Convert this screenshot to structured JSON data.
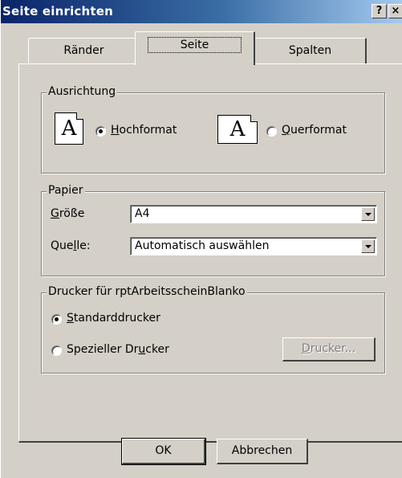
{
  "window": {
    "title": "Seite einrichten",
    "help_button": "?",
    "close_button": "×"
  },
  "tabs": [
    {
      "label": "Ränder",
      "active": false
    },
    {
      "label": "Seite",
      "active": true
    },
    {
      "label": "Spalten",
      "active": false
    }
  ],
  "ausrichtung": {
    "title": "Ausrichtung",
    "hochformat": {
      "icon_glyph": "A",
      "accel": "H",
      "rest": "ochformat",
      "checked": true
    },
    "querformat": {
      "icon_glyph": "A",
      "accel": "Q",
      "rest": "uerformat",
      "checked": false
    }
  },
  "papier": {
    "title": "Papier",
    "groesse": {
      "accel": "G",
      "rest": "röße",
      "value": "A4"
    },
    "quelle": {
      "pre": "Que",
      "accel": "l",
      "rest": "le:",
      "value": "Automatisch auswählen"
    }
  },
  "drucker": {
    "title": "Drucker für rptArbeitsscheinBlanko",
    "standard": {
      "accel": "S",
      "rest": "tandarddrucker",
      "checked": true
    },
    "spezieller": {
      "pre": "Spezieller Dr",
      "accel": "u",
      "rest": "cker",
      "checked": false
    },
    "drucker_button": {
      "accel": "D",
      "rest": "rucker..."
    }
  },
  "buttons": {
    "ok": "OK",
    "cancel": "Abbrechen"
  },
  "colors": {
    "face": "#d4d0c8",
    "title_start": "#0a246a",
    "title_end": "#a6caf0"
  }
}
